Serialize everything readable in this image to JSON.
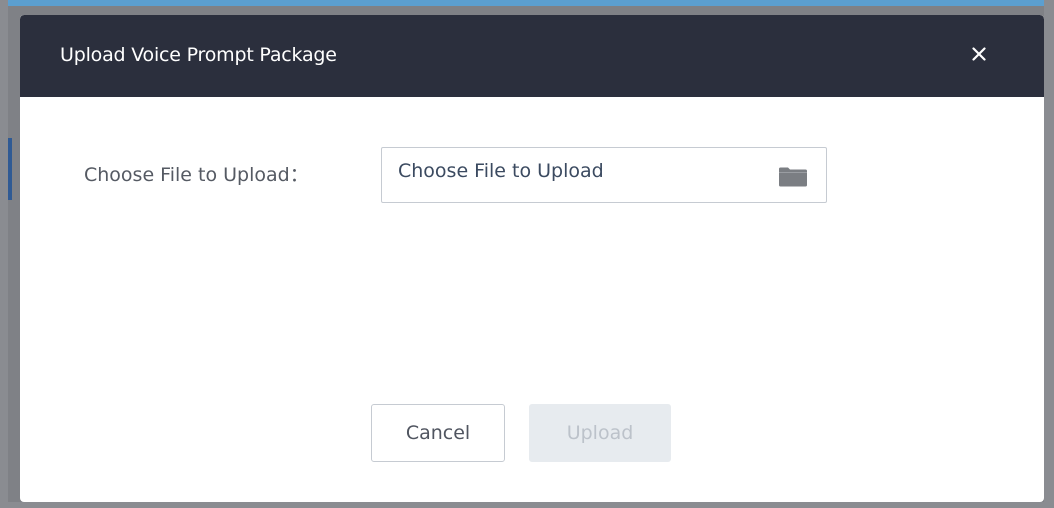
{
  "dialog": {
    "title": "Upload Voice Prompt Package",
    "close_icon": "close-icon"
  },
  "form": {
    "file_label": "Choose File to Upload：",
    "file_input_text": "Choose File to Upload",
    "folder_icon": "folder-icon"
  },
  "buttons": {
    "cancel_label": "Cancel",
    "upload_label": "Upload",
    "upload_disabled": true
  },
  "colors": {
    "header_bg": "#2b2f3d",
    "header_text": "#ffffff",
    "label_text": "#555a63",
    "input_text": "#3b4a60",
    "disabled_bg": "#e7ebef",
    "disabled_text": "#bcc2ca"
  }
}
